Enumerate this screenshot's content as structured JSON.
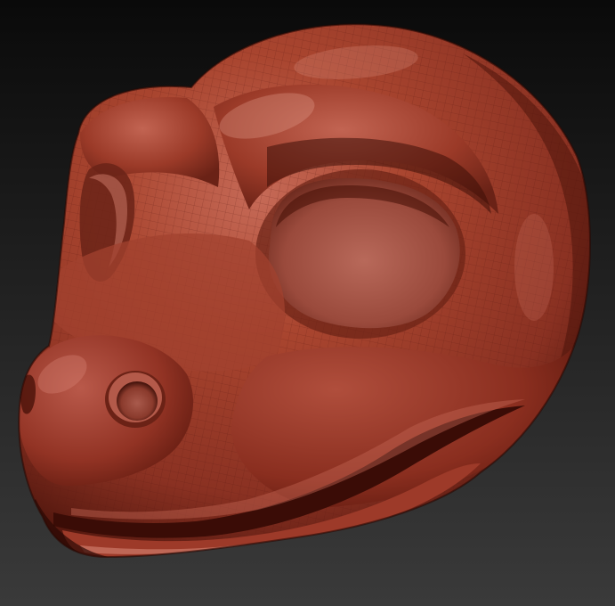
{
  "viewport": {
    "background_top": "#0a0a0a",
    "background_bottom": "#3a3a3a"
  },
  "model": {
    "subject": "sculpted-creature-head",
    "material": "red-wax-matcap",
    "colors": {
      "base": "#9c3a2a",
      "highlight": "#c9705e",
      "midtone": "#8a3122",
      "shadow": "#3d0f08",
      "deep_shadow": "#220604",
      "wireframe": "#6a2216"
    }
  }
}
